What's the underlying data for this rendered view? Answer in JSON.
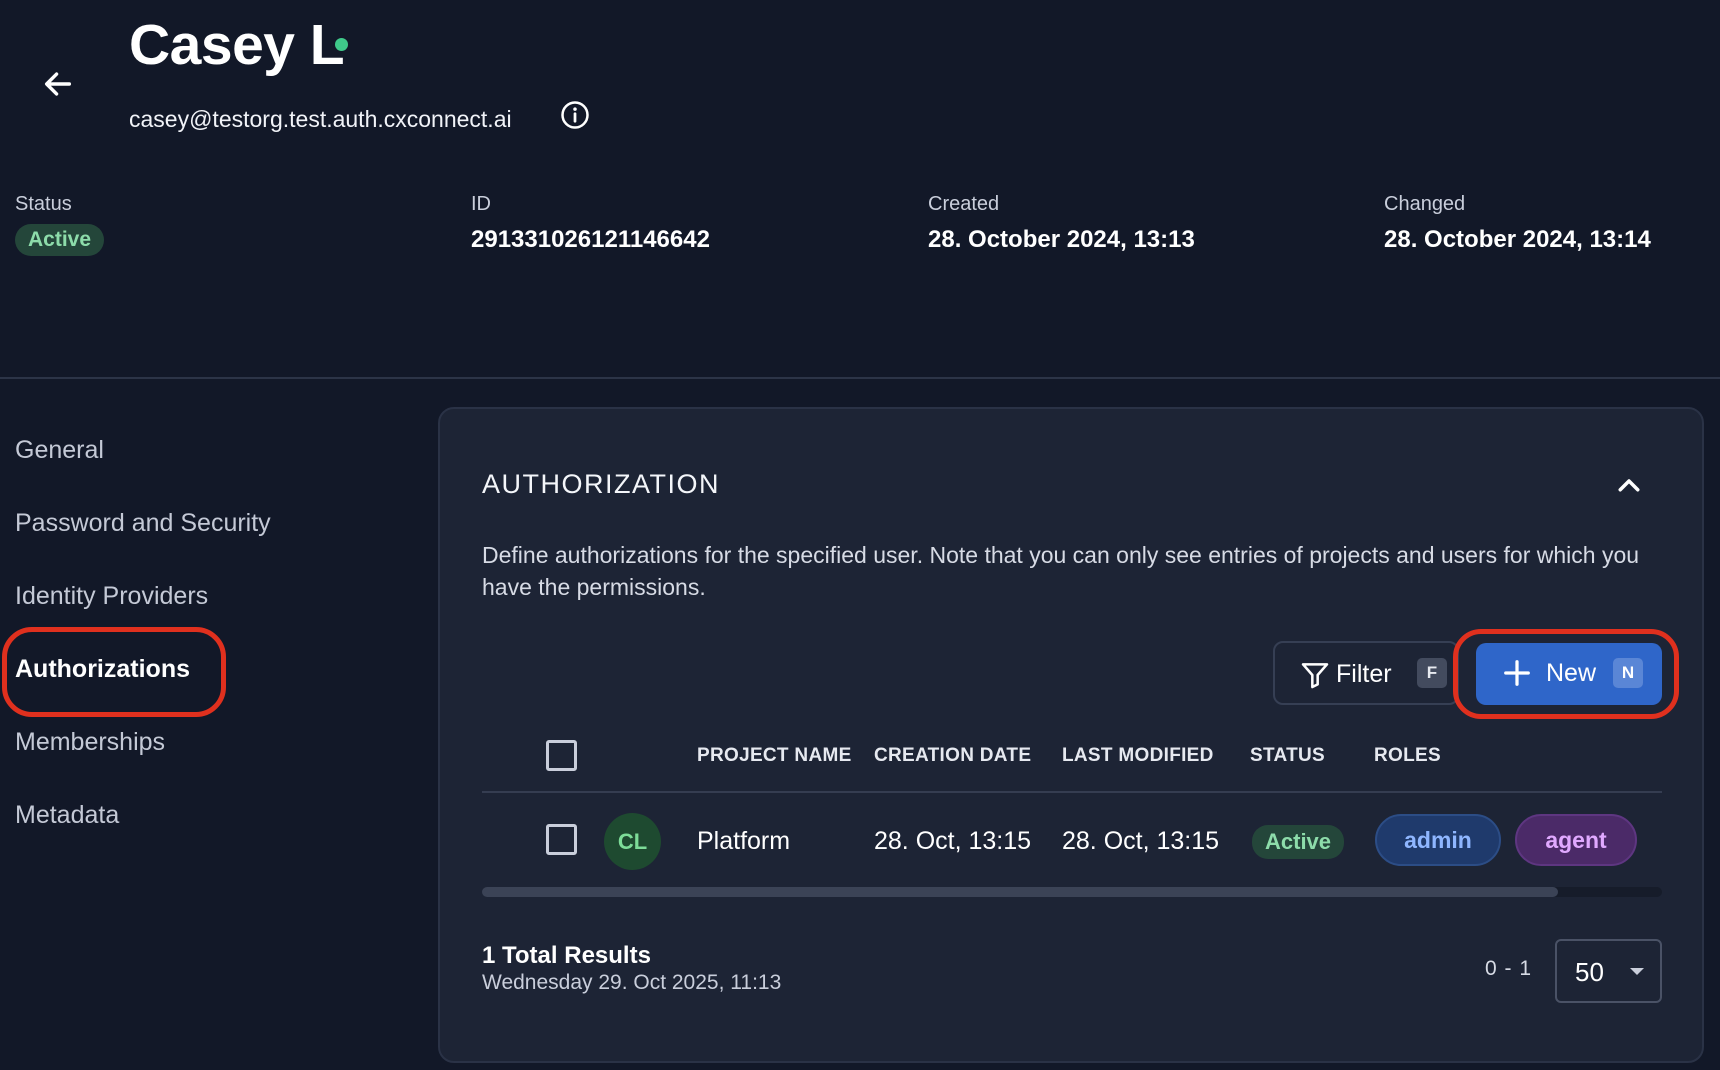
{
  "header": {
    "name": "Casey L",
    "email": "casey@testorg.test.auth.cxconnect.ai",
    "status_label": "Status",
    "status_value": "Active",
    "id_label": "ID",
    "id_value": "291331026121146642",
    "created_label": "Created",
    "created_value": "28. October 2024, 13:13",
    "changed_label": "Changed",
    "changed_value": "28. October 2024, 13:14"
  },
  "sidebar": {
    "items": [
      {
        "label": "General"
      },
      {
        "label": "Password and Security"
      },
      {
        "label": "Identity Providers"
      },
      {
        "label": "Authorizations"
      },
      {
        "label": "Memberships"
      },
      {
        "label": "Metadata"
      }
    ]
  },
  "authorization": {
    "title": "AUTHORIZATION",
    "description": "Define authorizations for the specified user. Note that you can only see entries of projects and users for which you have the permissions.",
    "filter_label": "Filter",
    "filter_shortcut": "F",
    "new_label": "New",
    "new_shortcut": "N",
    "columns": [
      "PROJECT NAME",
      "CREATION DATE",
      "LAST MODIFIED",
      "STATUS",
      "ROLES"
    ],
    "rows": [
      {
        "avatar": "CL",
        "project": "Platform",
        "created": "28. Oct, 13:15",
        "modified": "28. Oct, 13:15",
        "status": "Active",
        "roles": [
          "admin",
          "agent"
        ]
      }
    ],
    "total_results": "1 Total Results",
    "timestamp": "Wednesday 29. Oct 2025, 11:13",
    "range": "0 - 1",
    "page_size": "50"
  },
  "colors": {
    "background": "#121828",
    "card": "#1d2435",
    "primary": "#2f66c9",
    "active_status": "#8ddcaa",
    "highlight_ring": "#e0301e",
    "online": "#3fc98a"
  },
  "icons": {
    "back": "arrow-left-icon",
    "info": "info-icon",
    "collapse": "chevron-up-icon",
    "filter": "filter-icon",
    "new": "plus-icon",
    "page_size": "caret-down-icon"
  }
}
